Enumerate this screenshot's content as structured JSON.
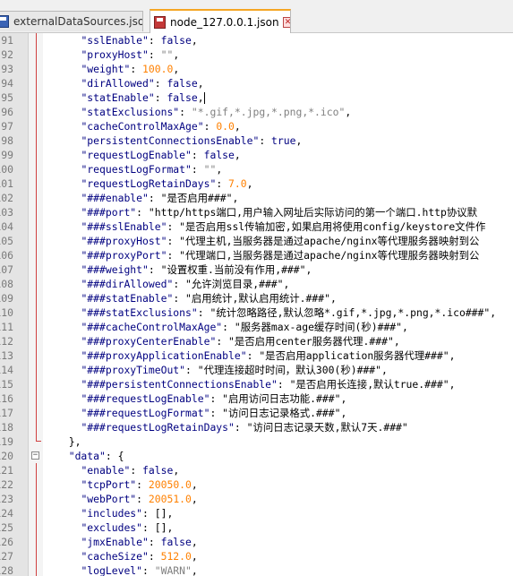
{
  "tabs": [
    {
      "label": "externalDataSources.json",
      "active": false,
      "status": "saved"
    },
    {
      "label": "node_127.0.0.1.json",
      "active": true,
      "status": "modified"
    }
  ],
  "colors": {
    "key": "#000080",
    "string": "#808080",
    "number": "#ff8000",
    "fold": "#d04040",
    "active_tab_accent": "#f5a623"
  },
  "lines": [
    {
      "n": "91",
      "indent": "    ",
      "k": "sslEnable",
      "kind": "kw",
      "v": "false",
      "end": ","
    },
    {
      "n": "92",
      "indent": "    ",
      "k": "proxyHost",
      "kind": "str",
      "v": "\"\"",
      "end": ","
    },
    {
      "n": "93",
      "indent": "    ",
      "k": "weight",
      "kind": "num",
      "v": "100.0",
      "end": ","
    },
    {
      "n": "94",
      "indent": "    ",
      "k": "dirAllowed",
      "kind": "kw",
      "v": "false",
      "end": ","
    },
    {
      "n": "95",
      "indent": "    ",
      "k": "statEnable",
      "kind": "kw",
      "v": "false",
      "end": ",",
      "caret": true
    },
    {
      "n": "96",
      "indent": "    ",
      "k": "statExclusions",
      "kind": "str",
      "v": "\"*.gif,*.jpg,*.png,*.ico\"",
      "end": ","
    },
    {
      "n": "97",
      "indent": "    ",
      "k": "cacheControlMaxAge",
      "kind": "num",
      "v": "0.0",
      "end": ","
    },
    {
      "n": "98",
      "indent": "    ",
      "k": "persistentConnectionsEnable",
      "kind": "kw",
      "v": "true",
      "end": ","
    },
    {
      "n": "99",
      "indent": "    ",
      "k": "requestLogEnable",
      "kind": "kw",
      "v": "false",
      "end": ","
    },
    {
      "n": "100",
      "indent": "    ",
      "k": "requestLogFormat",
      "kind": "str",
      "v": "\"\"",
      "end": ","
    },
    {
      "n": "101",
      "indent": "    ",
      "k": "requestLogRetainDays",
      "kind": "num",
      "v": "7.0",
      "end": ","
    },
    {
      "n": "102",
      "indent": "    ",
      "k": "###enable",
      "kind": "str",
      "v": "\"是否启用###\"",
      "end": ","
    },
    {
      "n": "103",
      "indent": "    ",
      "k": "###port",
      "kind": "str",
      "v": "\"http/https端口,用户输入网址后实际访问的第一个端口.http协议默",
      "end": ""
    },
    {
      "n": "104",
      "indent": "    ",
      "k": "###sslEnable",
      "kind": "str",
      "v": "\"是否启用ssl传输加密,如果启用将使用config/keystore文件作",
      "end": ""
    },
    {
      "n": "105",
      "indent": "    ",
      "k": "###proxyHost",
      "kind": "str",
      "v": "\"代理主机,当服务器是通过apache/nginx等代理服务器映射到公",
      "end": ""
    },
    {
      "n": "106",
      "indent": "    ",
      "k": "###proxyPort",
      "kind": "str",
      "v": "\"代理端口,当服务器是通过apache/nginx等代理服务器映射到公",
      "end": ""
    },
    {
      "n": "107",
      "indent": "    ",
      "k": "###weight",
      "kind": "str",
      "v": "\"设置权重.当前没有作用,###\"",
      "end": ","
    },
    {
      "n": "108",
      "indent": "    ",
      "k": "###dirAllowed",
      "kind": "str",
      "v": "\"允许浏览目录,###\"",
      "end": ","
    },
    {
      "n": "109",
      "indent": "    ",
      "k": "###statEnable",
      "kind": "str",
      "v": "\"启用统计,默认启用统计.###\"",
      "end": ","
    },
    {
      "n": "110",
      "indent": "    ",
      "k": "###statExclusions",
      "kind": "str",
      "v": "\"统计忽略路径,默认忽略*.gif,*.jpg,*.png,*.ico###\"",
      "end": ","
    },
    {
      "n": "111",
      "indent": "    ",
      "k": "###cacheControlMaxAge",
      "kind": "str",
      "v": "\"服务器max-age缓存时间(秒)###\"",
      "end": ","
    },
    {
      "n": "112",
      "indent": "    ",
      "k": "###proxyCenterEnable",
      "kind": "str",
      "v": "\"是否启用center服务器代理.###\"",
      "end": ","
    },
    {
      "n": "113",
      "indent": "    ",
      "k": "###proxyApplicationEnable",
      "kind": "str",
      "v": "\"是否启用application服务器代理###\"",
      "end": ","
    },
    {
      "n": "114",
      "indent": "    ",
      "k": "###proxyTimeOut",
      "kind": "str",
      "v": "\"代理连接超时时间，默认300(秒)###\"",
      "end": ","
    },
    {
      "n": "115",
      "indent": "    ",
      "k": "###persistentConnectionsEnable",
      "kind": "str",
      "v": "\"是否启用长连接,默认true.###\"",
      "end": ","
    },
    {
      "n": "116",
      "indent": "    ",
      "k": "###requestLogEnable",
      "kind": "str",
      "v": "\"启用访问日志功能.###\"",
      "end": ","
    },
    {
      "n": "117",
      "indent": "    ",
      "k": "###requestLogFormat",
      "kind": "str",
      "v": "\"访问日志记录格式.###\"",
      "end": ","
    },
    {
      "n": "118",
      "indent": "    ",
      "k": "###requestLogRetainDays",
      "kind": "str",
      "v": "\"访问日志记录天数,默认7天.###\"",
      "end": ""
    },
    {
      "n": "119",
      "indent": "  ",
      "raw": "},",
      "foldend": true
    },
    {
      "n": "120",
      "indent": "  ",
      "k": "data",
      "kind": "raw",
      "v": "{",
      "end": "",
      "fold": "−"
    },
    {
      "n": "121",
      "indent": "    ",
      "k": "enable",
      "kind": "kw",
      "v": "false",
      "end": ","
    },
    {
      "n": "122",
      "indent": "    ",
      "k": "tcpPort",
      "kind": "num",
      "v": "20050.0",
      "end": ","
    },
    {
      "n": "123",
      "indent": "    ",
      "k": "webPort",
      "kind": "num",
      "v": "20051.0",
      "end": ","
    },
    {
      "n": "124",
      "indent": "    ",
      "k": "includes",
      "kind": "raw",
      "v": "[]",
      "end": ","
    },
    {
      "n": "125",
      "indent": "    ",
      "k": "excludes",
      "kind": "raw",
      "v": "[]",
      "end": ","
    },
    {
      "n": "126",
      "indent": "    ",
      "k": "jmxEnable",
      "kind": "kw",
      "v": "false",
      "end": ","
    },
    {
      "n": "127",
      "indent": "    ",
      "k": "cacheSize",
      "kind": "num",
      "v": "512.0",
      "end": ","
    },
    {
      "n": "128",
      "indent": "    ",
      "k": "logLevel",
      "kind": "str",
      "v": "\"WARN\"",
      "end": ","
    }
  ]
}
